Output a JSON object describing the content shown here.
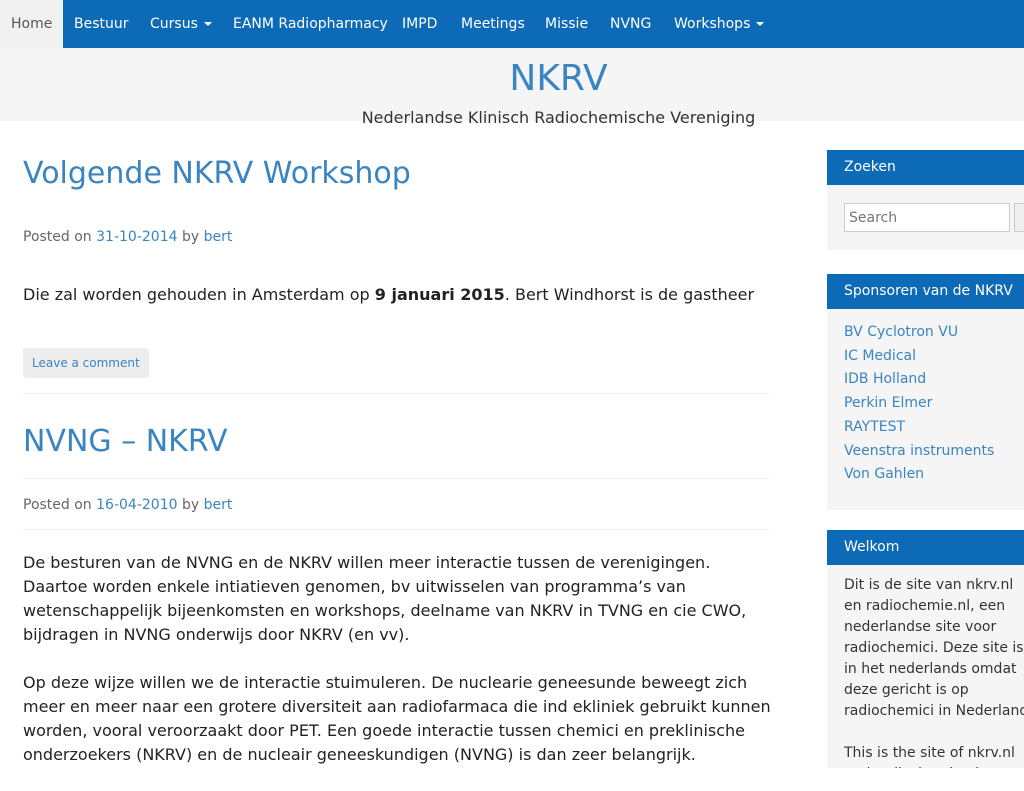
{
  "nav": {
    "items": [
      {
        "label": "Home",
        "active": true
      },
      {
        "label": "Bestuur"
      },
      {
        "label": "Cursus",
        "dropdown": true
      },
      {
        "label": "EANM Radiopharmacy"
      },
      {
        "label": "IMPD"
      },
      {
        "label": "Meetings"
      },
      {
        "label": "Missie"
      },
      {
        "label": "NVNG"
      },
      {
        "label": "Workshops",
        "dropdown": true
      }
    ]
  },
  "site": {
    "title": "NKRV",
    "description": "Nederlandse Klinisch Radiochemische Vereniging"
  },
  "posts": [
    {
      "title": "Volgende NKRV Workshop",
      "meta_prefix": "Posted on",
      "date": "31-10-2014",
      "meta_by": "by",
      "author": "bert",
      "body_before": "Die zal worden gehouden in Amsterdam op ",
      "body_bold": "9 januari 2015",
      "body_after": ". Bert Windhorst is de gastheer",
      "comment_label": "Leave a comment"
    },
    {
      "title": "NVNG – NKRV",
      "meta_prefix": "Posted on",
      "date": "16-04-2010",
      "meta_by": "by",
      "author": "bert",
      "paragraphs": [
        "De besturen van de NVNG en de NKRV willen meer interactie tussen de verenigingen. Daartoe worden enkele intiatieven genomen, bv uitwisselen van programma’s van wetenschappelijk bijeenkomsten en workshops, deelname van NKRV in TVNG en cie CWO, bijdragen in NVNG onderwijs door NKRV (en vv).",
        "Op deze wijze willen we de interactie stuimuleren. De nuclearie geneesunde beweegt zich meer en meer naar een grotere diversiteit aan radiofarmaca die ind ekliniek gebruikt kunnen worden, vooral veroorzaakt door PET. Een goede interactie tussen chemici en preklinische onderzoekers (NKRV) en de nucleair geneeskundigen (NVNG) is dan zeer belangrijk."
      ]
    }
  ],
  "sidebar": {
    "search": {
      "title": "Zoeken",
      "placeholder": "Search"
    },
    "sponsors": {
      "title": "Sponsoren van de NKRV",
      "items": [
        "BV Cyclotron VU",
        "IC Medical",
        "IDB Holland",
        "Perkin Elmer",
        "RAYTEST",
        "Veenstra instruments",
        "Von Gahlen"
      ]
    },
    "welcome": {
      "title": "Welkom",
      "paragraphs": [
        "Dit is de site van nkrv.nl en radiochemie.nl, een nederlandse site voor radiochemici. Deze site is in het nederlands omdat deze gericht is op radiochemici in Nederland.",
        "This is the site of nkrv.nl and radiochemie.nl, a dutch site"
      ]
    }
  },
  "colors": {
    "primary": "#0c6ab7",
    "link": "#3a84c1",
    "header_bg": "#f5f5f5"
  }
}
